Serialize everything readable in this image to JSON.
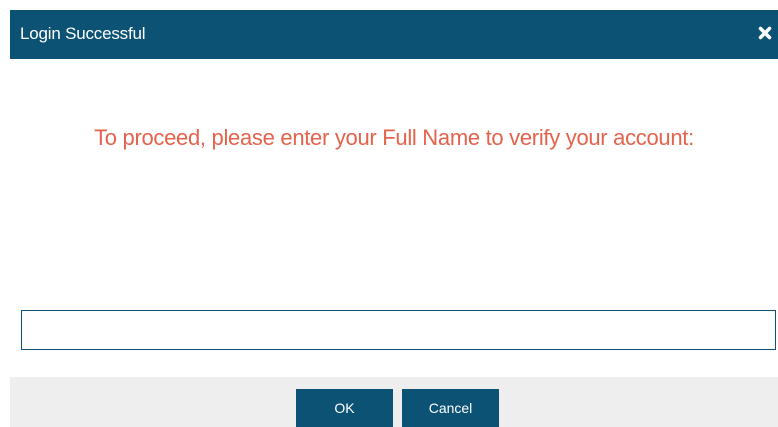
{
  "dialog": {
    "title": "Login Successful",
    "close_icon": "close-icon",
    "message": "To proceed, please enter your Full Name to verify your account:",
    "input": {
      "value": "",
      "placeholder": ""
    },
    "buttons": {
      "ok_label": "OK",
      "cancel_label": "Cancel"
    }
  },
  "colors": {
    "header_background": "#0b5274",
    "message_text": "#e5624c",
    "footer_background": "#eeeeee",
    "button_background": "#0b5274"
  }
}
